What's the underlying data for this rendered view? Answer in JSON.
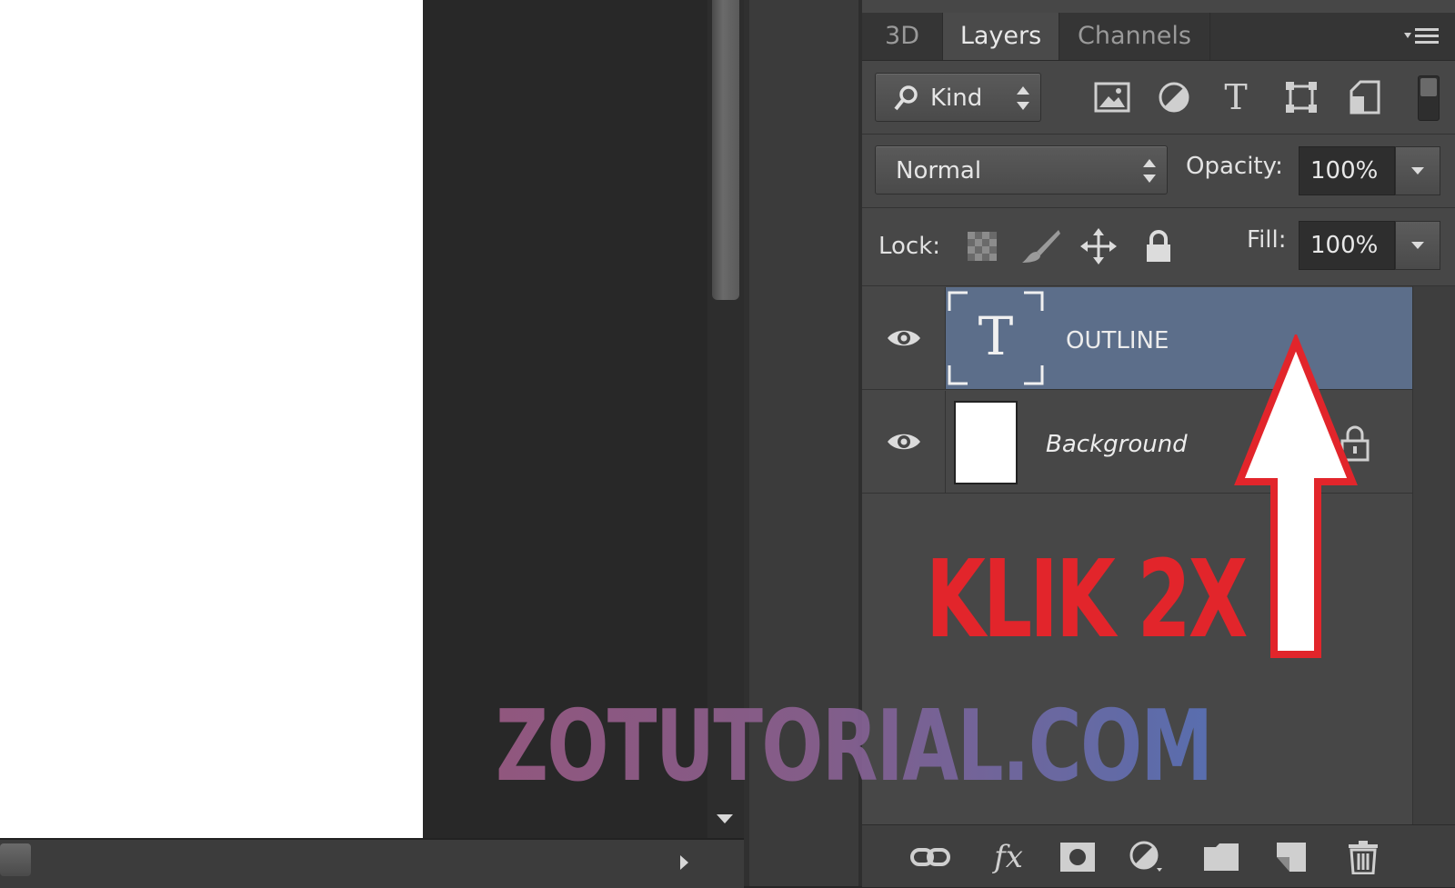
{
  "tabs": [
    {
      "label": "3D"
    },
    {
      "label": "Layers"
    },
    {
      "label": "Channels"
    }
  ],
  "panel_menu_icon": "panel-menu-icon",
  "filter": {
    "kind_label": "Kind",
    "icons": [
      "image-filter-icon",
      "adjustment-filter-icon",
      "type-filter-icon",
      "shape-filter-icon",
      "smart-object-filter-icon"
    ],
    "type_glyph": "T"
  },
  "blend": {
    "mode": "Normal",
    "opacity_label": "Opacity:",
    "opacity_value": "100%"
  },
  "lock": {
    "label": "Lock:",
    "fill_label": "Fill:",
    "fill_value": "100%",
    "icons": [
      "lock-transparent-icon",
      "lock-image-icon",
      "lock-position-icon",
      "lock-all-icon"
    ]
  },
  "layers": [
    {
      "name": "OUTLINE",
      "type": "text",
      "selected": true,
      "thumb_glyph": "T"
    },
    {
      "name": "Background",
      "type": "image",
      "selected": false,
      "locked": true
    }
  ],
  "bottom_icons": [
    "link-layers-icon",
    "fx-icon",
    "add-mask-icon",
    "adjustment-layer-icon",
    "new-group-icon",
    "new-layer-icon",
    "delete-icon"
  ],
  "fx_label": "fx",
  "annotation": {
    "text": "KLIK 2X",
    "color": "#e2252b"
  },
  "watermark": "ZOTUTORIAL.COM",
  "colors": {
    "selection": "#5c6e8a",
    "panel": "#474747"
  }
}
